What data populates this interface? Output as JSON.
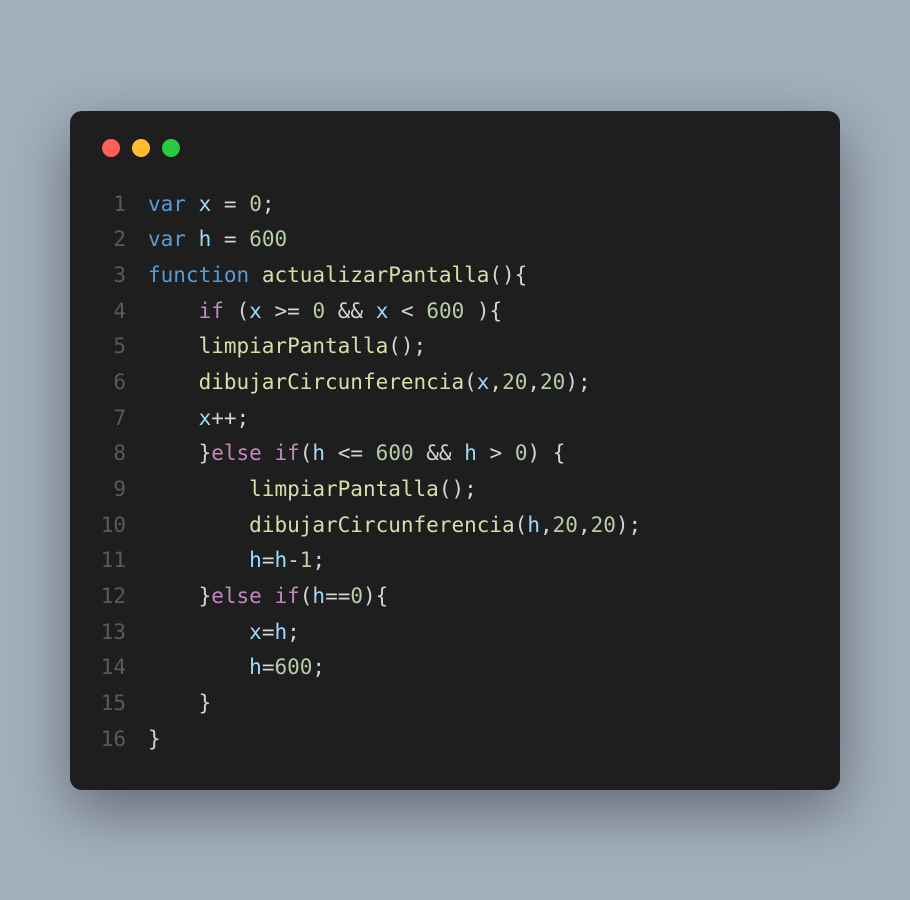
{
  "titlebar": {
    "buttons": [
      "close",
      "minimize",
      "maximize"
    ]
  },
  "code": {
    "lines": [
      {
        "num": "1",
        "tokens": [
          {
            "t": "var",
            "c": "kw"
          },
          {
            "t": " ",
            "c": "txt"
          },
          {
            "t": "x",
            "c": "var"
          },
          {
            "t": " ",
            "c": "txt"
          },
          {
            "t": "=",
            "c": "op"
          },
          {
            "t": " ",
            "c": "txt"
          },
          {
            "t": "0",
            "c": "num"
          },
          {
            "t": ";",
            "c": "txt"
          }
        ]
      },
      {
        "num": "2",
        "tokens": [
          {
            "t": "var",
            "c": "kw"
          },
          {
            "t": " ",
            "c": "txt"
          },
          {
            "t": "h",
            "c": "var"
          },
          {
            "t": " ",
            "c": "txt"
          },
          {
            "t": "=",
            "c": "op"
          },
          {
            "t": " ",
            "c": "txt"
          },
          {
            "t": "600",
            "c": "num"
          }
        ]
      },
      {
        "num": "3",
        "tokens": [
          {
            "t": "function",
            "c": "kw"
          },
          {
            "t": " ",
            "c": "txt"
          },
          {
            "t": "actualizarPantalla",
            "c": "fn"
          },
          {
            "t": "(){",
            "c": "txt"
          }
        ]
      },
      {
        "num": "4",
        "tokens": [
          {
            "t": "    ",
            "c": "txt"
          },
          {
            "t": "if",
            "c": "kw2"
          },
          {
            "t": " (",
            "c": "txt"
          },
          {
            "t": "x",
            "c": "var"
          },
          {
            "t": " ",
            "c": "txt"
          },
          {
            "t": ">=",
            "c": "op"
          },
          {
            "t": " ",
            "c": "txt"
          },
          {
            "t": "0",
            "c": "num"
          },
          {
            "t": " ",
            "c": "txt"
          },
          {
            "t": "&&",
            "c": "op"
          },
          {
            "t": " ",
            "c": "txt"
          },
          {
            "t": "x",
            "c": "var"
          },
          {
            "t": " ",
            "c": "txt"
          },
          {
            "t": "<",
            "c": "op"
          },
          {
            "t": " ",
            "c": "txt"
          },
          {
            "t": "600",
            "c": "num"
          },
          {
            "t": " ){",
            "c": "txt"
          }
        ]
      },
      {
        "num": "5",
        "tokens": [
          {
            "t": "    ",
            "c": "txt"
          },
          {
            "t": "limpiarPantalla",
            "c": "fn"
          },
          {
            "t": "();",
            "c": "txt"
          }
        ]
      },
      {
        "num": "6",
        "tokens": [
          {
            "t": "    ",
            "c": "txt"
          },
          {
            "t": "dibujarCircunferencia",
            "c": "fn"
          },
          {
            "t": "(",
            "c": "txt"
          },
          {
            "t": "x",
            "c": "var"
          },
          {
            "t": ",",
            "c": "txt"
          },
          {
            "t": "20",
            "c": "num"
          },
          {
            "t": ",",
            "c": "txt"
          },
          {
            "t": "20",
            "c": "num"
          },
          {
            "t": ");",
            "c": "txt"
          }
        ]
      },
      {
        "num": "7",
        "tokens": [
          {
            "t": "    ",
            "c": "txt"
          },
          {
            "t": "x",
            "c": "var"
          },
          {
            "t": "++;",
            "c": "op"
          }
        ]
      },
      {
        "num": "8",
        "tokens": [
          {
            "t": "    }",
            "c": "txt"
          },
          {
            "t": "else",
            "c": "kw2"
          },
          {
            "t": " ",
            "c": "txt"
          },
          {
            "t": "if",
            "c": "kw2"
          },
          {
            "t": "(",
            "c": "txt"
          },
          {
            "t": "h",
            "c": "var"
          },
          {
            "t": " ",
            "c": "txt"
          },
          {
            "t": "<=",
            "c": "op"
          },
          {
            "t": " ",
            "c": "txt"
          },
          {
            "t": "600",
            "c": "num"
          },
          {
            "t": " ",
            "c": "txt"
          },
          {
            "t": "&&",
            "c": "op"
          },
          {
            "t": " ",
            "c": "txt"
          },
          {
            "t": "h",
            "c": "var"
          },
          {
            "t": " ",
            "c": "txt"
          },
          {
            "t": ">",
            "c": "op"
          },
          {
            "t": " ",
            "c": "txt"
          },
          {
            "t": "0",
            "c": "num"
          },
          {
            "t": ") {",
            "c": "txt"
          }
        ]
      },
      {
        "num": "9",
        "tokens": [
          {
            "t": "        ",
            "c": "txt"
          },
          {
            "t": "limpiarPantalla",
            "c": "fn"
          },
          {
            "t": "();",
            "c": "txt"
          }
        ]
      },
      {
        "num": "10",
        "tokens": [
          {
            "t": "        ",
            "c": "txt"
          },
          {
            "t": "dibujarCircunferencia",
            "c": "fn"
          },
          {
            "t": "(",
            "c": "txt"
          },
          {
            "t": "h",
            "c": "var"
          },
          {
            "t": ",",
            "c": "txt"
          },
          {
            "t": "20",
            "c": "num"
          },
          {
            "t": ",",
            "c": "txt"
          },
          {
            "t": "20",
            "c": "num"
          },
          {
            "t": ");",
            "c": "txt"
          }
        ]
      },
      {
        "num": "11",
        "tokens": [
          {
            "t": "        ",
            "c": "txt"
          },
          {
            "t": "h",
            "c": "var"
          },
          {
            "t": "=",
            "c": "op"
          },
          {
            "t": "h",
            "c": "var"
          },
          {
            "t": "-",
            "c": "op"
          },
          {
            "t": "1",
            "c": "num"
          },
          {
            "t": ";",
            "c": "txt"
          }
        ]
      },
      {
        "num": "12",
        "tokens": [
          {
            "t": "    }",
            "c": "txt"
          },
          {
            "t": "else",
            "c": "kw2"
          },
          {
            "t": " ",
            "c": "txt"
          },
          {
            "t": "if",
            "c": "kw2"
          },
          {
            "t": "(",
            "c": "txt"
          },
          {
            "t": "h",
            "c": "var"
          },
          {
            "t": "==",
            "c": "op"
          },
          {
            "t": "0",
            "c": "num"
          },
          {
            "t": "){",
            "c": "txt"
          }
        ]
      },
      {
        "num": "13",
        "tokens": [
          {
            "t": "        ",
            "c": "txt"
          },
          {
            "t": "x",
            "c": "var"
          },
          {
            "t": "=",
            "c": "op"
          },
          {
            "t": "h",
            "c": "var"
          },
          {
            "t": ";",
            "c": "txt"
          }
        ]
      },
      {
        "num": "14",
        "tokens": [
          {
            "t": "        ",
            "c": "txt"
          },
          {
            "t": "h",
            "c": "var"
          },
          {
            "t": "=",
            "c": "op"
          },
          {
            "t": "600",
            "c": "num"
          },
          {
            "t": ";",
            "c": "txt"
          }
        ]
      },
      {
        "num": "15",
        "tokens": [
          {
            "t": "    }",
            "c": "txt"
          }
        ]
      },
      {
        "num": "16",
        "tokens": [
          {
            "t": "}",
            "c": "txt"
          }
        ]
      }
    ]
  }
}
